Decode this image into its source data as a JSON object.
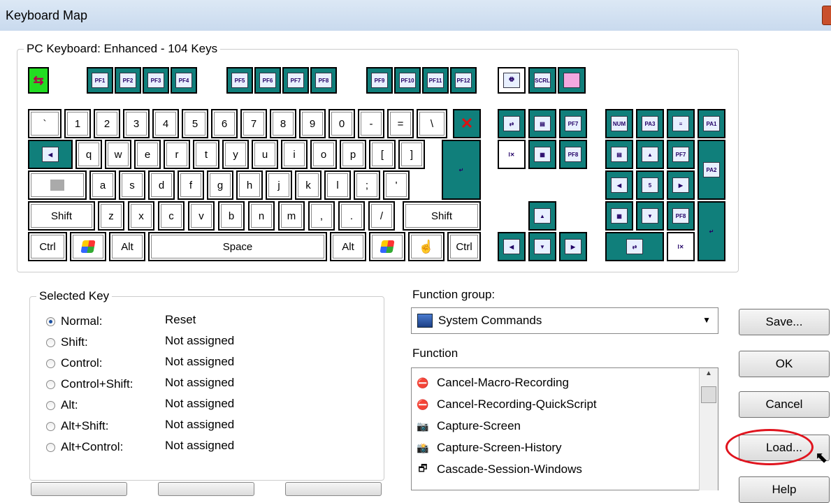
{
  "window": {
    "title": "Keyboard Map"
  },
  "keyboard": {
    "legend": "PC Keyboard:  Enhanced - 104 Keys",
    "pf_top": [
      "PF1",
      "PF2",
      "PF3",
      "PF4",
      "PF5",
      "PF6",
      "PF7",
      "PF8",
      "PF9",
      "PF10",
      "PF11",
      "PF12"
    ],
    "row_num": [
      "`",
      "1",
      "2",
      "3",
      "4",
      "5",
      "6",
      "7",
      "8",
      "9",
      "0",
      "-",
      "=",
      "\\"
    ],
    "row_q": [
      "q",
      "w",
      "e",
      "r",
      "t",
      "y",
      "u",
      "i",
      "o",
      "p",
      "[",
      "]"
    ],
    "row_a": [
      "a",
      "s",
      "d",
      "f",
      "g",
      "h",
      "j",
      "k",
      "l",
      ";",
      "'"
    ],
    "row_z": [
      "z",
      "x",
      "c",
      "v",
      "b",
      "n",
      "m",
      ",",
      ".",
      "/"
    ],
    "shift_left": "Shift",
    "shift_right": "Shift",
    "ctrl_left": "Ctrl",
    "ctrl_right": "Ctrl",
    "alt_left": "Alt",
    "alt_right": "Alt",
    "space": "Space",
    "scrl": "SCRL",
    "num": "NUM",
    "pa3": "PA3",
    "pa1": "PA1",
    "pa2": "PA2",
    "pf7_mid": "PF7",
    "pf8_mid": "PF8",
    "pf7_pad": "PF7",
    "pf8_pad": "PF8",
    "five": "5"
  },
  "selected_key": {
    "legend": "Selected Key",
    "options": [
      {
        "label": "Normal:",
        "value": "Reset",
        "selected": true
      },
      {
        "label": "Shift:",
        "value": "Not assigned"
      },
      {
        "label": "Control:",
        "value": "Not assigned"
      },
      {
        "label": "Control+Shift:",
        "value": "Not assigned"
      },
      {
        "label": "Alt:",
        "value": "Not assigned"
      },
      {
        "label": "Alt+Shift:",
        "value": "Not assigned"
      },
      {
        "label": "Alt+Control:",
        "value": "Not assigned"
      }
    ]
  },
  "function_group": {
    "label": "Function group:",
    "value": "System Commands"
  },
  "function": {
    "label": "Function",
    "items": [
      "Cancel-Macro-Recording",
      "Cancel-Recording-QuickScript",
      "Capture-Screen",
      "Capture-Screen-History",
      "Cascade-Session-Windows"
    ]
  },
  "buttons": {
    "save": "Save...",
    "ok": "OK",
    "cancel": "Cancel",
    "load": "Load...",
    "help": "Help"
  },
  "colors": {
    "function_key": "#107f7b",
    "highlight_oval": "#e0141e"
  }
}
